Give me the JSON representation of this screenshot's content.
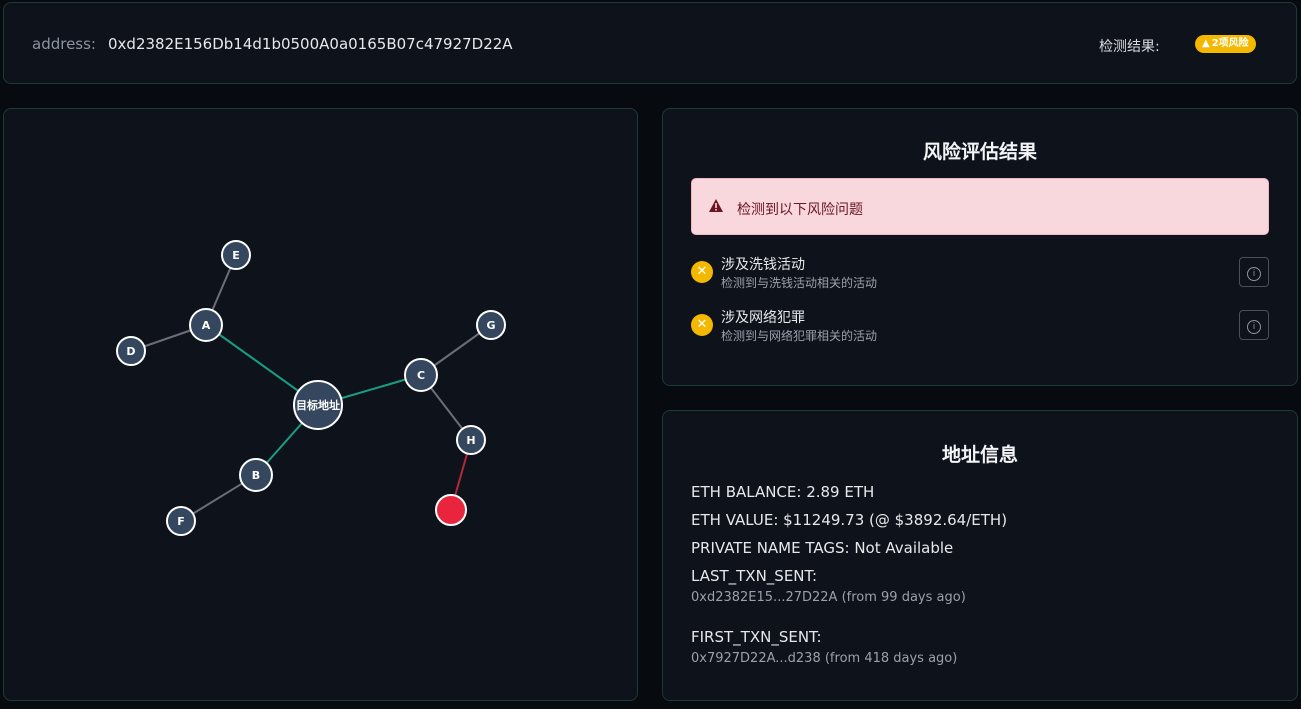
{
  "header": {
    "address_label": "address:",
    "address_value": "0xd2382E156Db14d1b0500A0a0165B07c47927D22A",
    "result_label": "检测结果:",
    "risk_badge": "2项风险",
    "badge_color": "#f5b800"
  },
  "graph": {
    "nodes": [
      {
        "id": "target",
        "label": "目标地址",
        "type": "target"
      },
      {
        "id": "A",
        "label": "A"
      },
      {
        "id": "B",
        "label": "B"
      },
      {
        "id": "C",
        "label": "C"
      },
      {
        "id": "D",
        "label": "D"
      },
      {
        "id": "E",
        "label": "E"
      },
      {
        "id": "F",
        "label": "F"
      },
      {
        "id": "G",
        "label": "G"
      },
      {
        "id": "H",
        "label": "H"
      },
      {
        "id": "R",
        "label": "",
        "type": "risk"
      }
    ],
    "edges": [
      {
        "from": "target",
        "to": "A",
        "kind": "primary"
      },
      {
        "from": "target",
        "to": "B",
        "kind": "primary"
      },
      {
        "from": "target",
        "to": "C",
        "kind": "primary"
      },
      {
        "from": "A",
        "to": "D",
        "kind": "secondary"
      },
      {
        "from": "A",
        "to": "E",
        "kind": "secondary"
      },
      {
        "from": "B",
        "to": "F",
        "kind": "secondary"
      },
      {
        "from": "C",
        "to": "G",
        "kind": "secondary"
      },
      {
        "from": "C",
        "to": "H",
        "kind": "secondary"
      },
      {
        "from": "H",
        "to": "R",
        "kind": "risk"
      }
    ],
    "colors": {
      "node_fill": "#34475e",
      "primary_edge": "#1a9e85",
      "secondary_edge": "#6b6e78",
      "risk_edge": "#b3273a",
      "risk_node": "#e8253d"
    }
  },
  "risk": {
    "title": "风险评估结果",
    "alert_text": "检测到以下风险问题",
    "items": [
      {
        "title": "涉及洗钱活动",
        "desc": "检测到与洗钱活动相关的活动",
        "icon": "x-circle-icon"
      },
      {
        "title": "涉及网络犯罪",
        "desc": "检测到与网络犯罪相关的活动",
        "icon": "x-circle-icon"
      }
    ]
  },
  "info": {
    "title": "地址信息",
    "eth_balance": "ETH BALANCE: 2.89 ETH",
    "eth_value": "ETH VALUE: $11249.73 (@ $3892.64/ETH)",
    "private_tags": "PRIVATE NAME TAGS: Not Available",
    "last_txn_label": "LAST_TXN_SENT:",
    "last_txn_value": "0xd2382E15...27D22A (from 99 days ago)",
    "first_txn_label": "FIRST_TXN_SENT:",
    "first_txn_value": "0x7927D22A...d238 (from 418 days ago)"
  }
}
